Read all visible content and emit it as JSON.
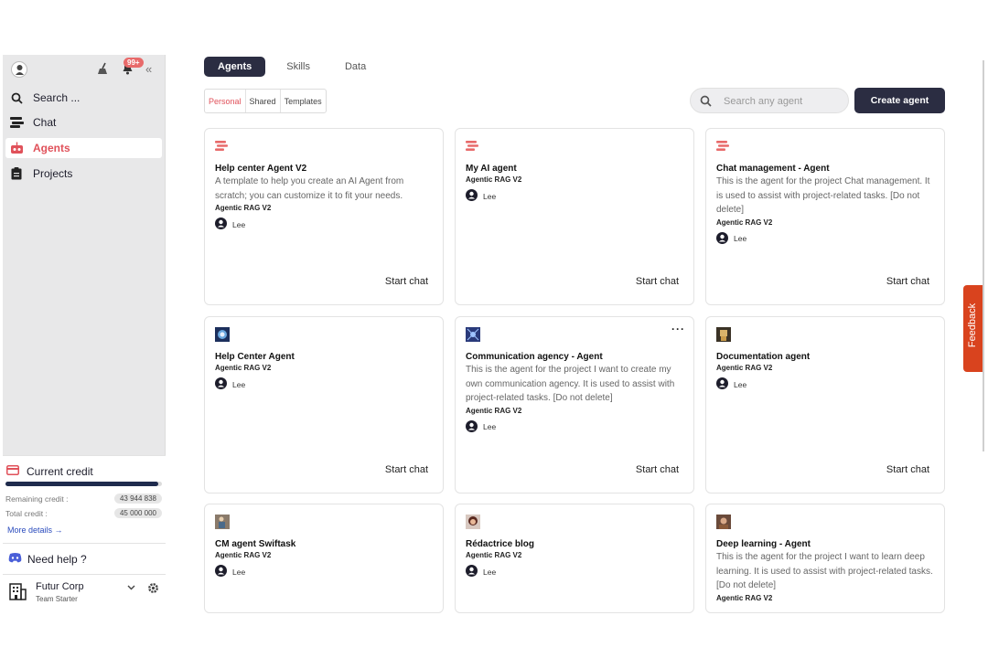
{
  "sidebar": {
    "notif_count": "99+",
    "collapse_glyph": "«",
    "items": [
      {
        "label": "Search ...",
        "icon": "search-icon"
      },
      {
        "label": "Chat",
        "icon": "chat-icon"
      },
      {
        "label": "Agents",
        "icon": "robot-icon"
      },
      {
        "label": "Projects",
        "icon": "clipboard-icon"
      }
    ],
    "credit": {
      "title": "Current credit",
      "remaining_label": "Remaining credit :",
      "remaining_value": "43 944 838",
      "total_label": "Total credit :",
      "total_value": "45 000 000",
      "fill_fraction": 0.977,
      "more_details": "More details →"
    },
    "help": "Need help ?",
    "org": {
      "name": "Futur Corp",
      "plan": "Team Starter"
    }
  },
  "main": {
    "tabs": [
      "Agents",
      "Skills",
      "Data"
    ],
    "subtabs": [
      "Personal",
      "Shared",
      "Templates"
    ],
    "search_placeholder": "Search any agent",
    "create_label": "Create agent"
  },
  "cards": [
    {
      "title": "Help center Agent V2",
      "desc": "A template to help you create an AI Agent from scratch; you can customize it to fit your needs.",
      "meta": "Agentic RAG V2",
      "owner": "Lee",
      "cta": "Start chat",
      "icon": "hamburger-icon"
    },
    {
      "title": "My AI agent",
      "desc": "",
      "meta": "Agentic RAG V2",
      "owner": "Lee",
      "cta": "Start chat",
      "icon": "hamburger-icon"
    },
    {
      "title": "Chat management - Agent",
      "desc": "This is the agent for the project Chat management. It is used to assist with project-related tasks. [Do not delete]",
      "meta": "Agentic RAG V2",
      "owner": "Lee",
      "cta": "Start chat",
      "icon": "hamburger-icon"
    },
    {
      "title": "Help Center Agent",
      "desc": "",
      "meta": "Agentic RAG V2",
      "owner": "Lee",
      "cta": "Start chat",
      "icon": "globe-image-icon"
    },
    {
      "title": "Communication agency - Agent",
      "desc": "This is the agent for the project I want to create my own communication agency. It is used to assist with project-related tasks. [Do not delete]",
      "meta": "Agentic RAG V2",
      "owner": "Lee",
      "cta": "Start chat",
      "icon": "network-image-icon",
      "more": "···"
    },
    {
      "title": "Documentation agent",
      "desc": "",
      "meta": "Agentic RAG V2",
      "owner": "Lee",
      "cta": "Start chat",
      "icon": "robot-image-icon"
    },
    {
      "title": "CM agent Swiftask",
      "desc": "",
      "meta": "Agentic RAG V2",
      "owner": "Lee",
      "cta": "",
      "icon": "figure-image-icon"
    },
    {
      "title": "Rédactrice blog",
      "desc": "",
      "meta": "Agentic RAG V2",
      "owner": "Lee",
      "cta": "",
      "icon": "woman-image-icon"
    },
    {
      "title": "Deep learning - Agent",
      "desc": "This is the agent for the project I want to learn deep learning. It is used to assist with project-related tasks. [Do not delete]",
      "meta": "Agentic RAG V2",
      "owner": "",
      "cta": "",
      "icon": "portrait-image-icon"
    }
  ],
  "feedback": "Feedback",
  "colors": {
    "accent": "#e0515a",
    "dark": "#2b2d42",
    "feedback": "#d9431e"
  }
}
